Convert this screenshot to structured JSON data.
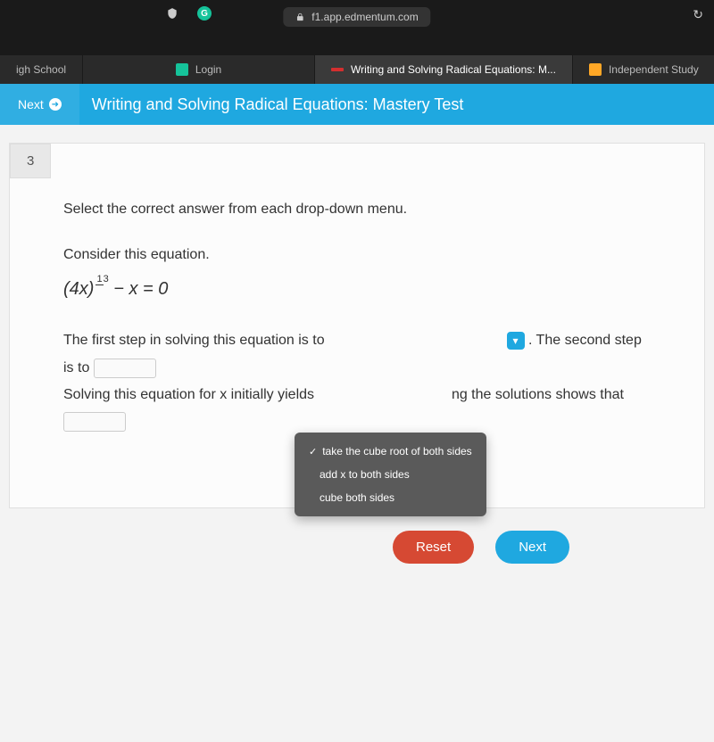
{
  "browser": {
    "url": "f1.app.edmentum.com",
    "tabs": [
      {
        "label": "igh School"
      },
      {
        "label": "Login"
      },
      {
        "label": "Writing and Solving Radical Equations: M...",
        "active": true
      },
      {
        "label": "Independent Study"
      }
    ]
  },
  "header": {
    "next_label": "Next",
    "page_title": "Writing and Solving Radical Equations: Mastery Test"
  },
  "question": {
    "number": "3",
    "instruction": "Select the correct answer from each drop-down menu.",
    "consider": "Consider this equation.",
    "equation_base": "(4x)",
    "equation_exp_top": "1",
    "equation_exp_bot": "3",
    "equation_rest": " − x  =  0",
    "line1_a": "The first step in solving this equation is to",
    "line1_b": ". The second step is to",
    "line2_a": "Solving this equation for x initially yields",
    "line2_b": "ng the solutions shows that"
  },
  "dropdown": {
    "options": [
      {
        "label": "take the cube root of both sides",
        "selected": true
      },
      {
        "label": "add x to both sides",
        "selected": false
      },
      {
        "label": "cube both sides",
        "selected": false
      }
    ]
  },
  "buttons": {
    "reset": "Reset",
    "next": "Next"
  }
}
